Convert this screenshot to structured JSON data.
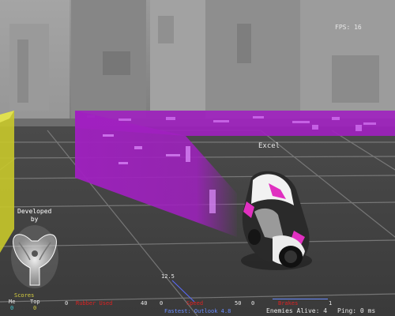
{
  "hud": {
    "fps_label": "FPS:",
    "fps_value": "16",
    "player_name": "Excel",
    "developed_by": "Developed\nby",
    "scores_label": "Scores",
    "scores_me_label": "Me",
    "scores_top_label": "Top",
    "scores_me_value": "0",
    "scores_top_value": "0",
    "speedometer_value": "12.5",
    "rubber": {
      "label": "Rubber Used",
      "min": "0",
      "max": "40",
      "level": 0.0
    },
    "speed": {
      "label": "Speed",
      "min": "0",
      "max": "50",
      "level": 0.22
    },
    "brakes": {
      "label": "Brakes",
      "min": "0",
      "max": "1",
      "level": 1.0
    },
    "fastest_label": "Fastest: Outlook 4.8",
    "enemies_label": "Enemies Alive: 4",
    "ping_label": "Ping: 0 ms"
  },
  "colors": {
    "wall": "#a020c0",
    "wall_light": "#c040e0",
    "yellow_wall": "#c8c82a",
    "label_red": "#dd2222",
    "label_blue": "#6a8cff",
    "hud_white": "#e8e8e8",
    "score_yellow": "#d8d040",
    "score_cyan": "#40c8d0"
  },
  "icons": {
    "logo": "winged-shield-logo",
    "cycle": "light-cycle"
  }
}
